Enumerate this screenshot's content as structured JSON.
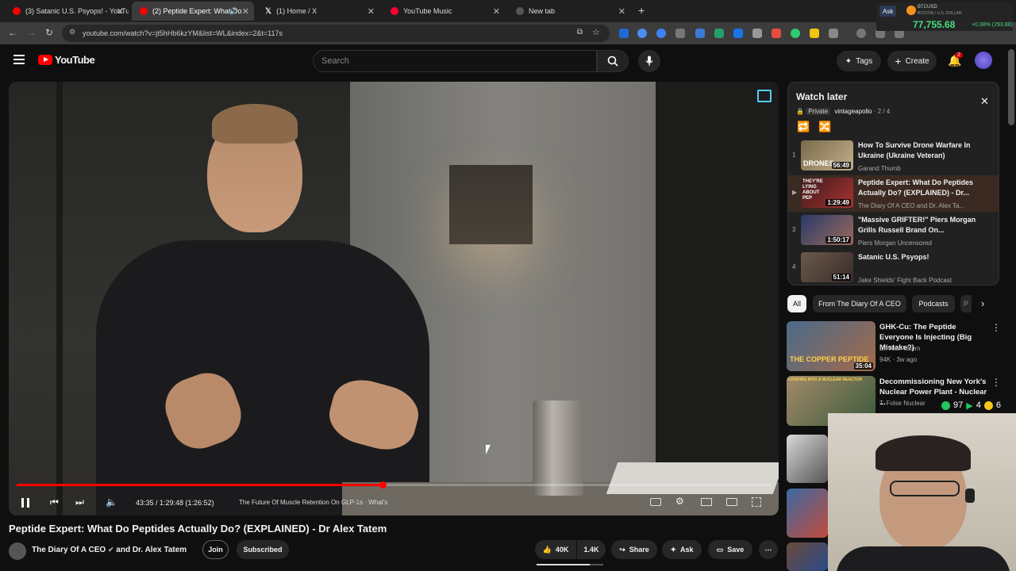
{
  "browser": {
    "tabs": [
      {
        "title": "(3) Satanic U.S. Psyops! - YouTu",
        "color": "#ff0000"
      },
      {
        "title": "(2) Peptide Expert: What Do",
        "color": "#ff0000"
      },
      {
        "title": "(1) Home / X",
        "color": "#ffffff"
      },
      {
        "title": "YouTube Music",
        "color": "#ff0033"
      },
      {
        "title": "New tab",
        "color": "#888888"
      }
    ],
    "url": "youtube.com/watch?v=jt5hHb6kzYM&list=WL&index=2&t=117s"
  },
  "ticker": {
    "ask": "Ask",
    "symbol": "BTCUSD",
    "subtitle": "BITCOIN / U.S. DOLLAR",
    "price": "77,755.68",
    "change": "+0.38% (293.88)"
  },
  "header": {
    "logo_text": "YouTube",
    "search_placeholder": "Search",
    "tags_label": "Tags",
    "create_label": "Create",
    "notif_count": "2"
  },
  "player": {
    "time": "43:35 / 1:29:48 (1:26:52)",
    "chapter": "The Future Of Muscle Retention On GLP-1s",
    "chapter_suffix": "· What's",
    "progress": 0.485
  },
  "video": {
    "title": "Peptide Expert: What Do Peptides Actually Do? (EXPLAINED) - Dr Alex Tatem",
    "channel": "The Diary Of A CEO",
    "channel_and": "and Dr. Alex Tatem",
    "join_label": "Join",
    "subscribed_label": "Subscribed",
    "likes": "40K",
    "dislikes": "1.4K",
    "share_label": "Share",
    "ask_label": "Ask",
    "save_label": "Save"
  },
  "playlist": {
    "title": "Watch later",
    "privacy": "Private",
    "owner": "vintageapollo",
    "position": "· 2 / 4",
    "items": [
      {
        "index": "1",
        "title": "How To Survive Drone Warfare In Ukraine (Ukraine Veteran)",
        "channel": "Garand Thumb",
        "duration": "56:49",
        "thumb_text": "DRONES"
      },
      {
        "index": "▶",
        "title": "Peptide Expert: What Do Peptides Actually Do? (EXPLAINED) - Dr...",
        "channel": "The Diary Of A CEO and Dr. Alex Ta...",
        "duration": "1:29:49",
        "thumb_text": "THEY'RE LYING ABOUT PEP"
      },
      {
        "index": "3",
        "title": "\"Massive GRIFTER!\" Piers Morgan Grills Russell Brand On...",
        "channel": "Piers Morgan Uncensored",
        "duration": "1:50:17",
        "thumb_text": ""
      },
      {
        "index": "4",
        "title": "Satanic U.S. Psyops!",
        "channel": "Jake Shields' Fight Back Podcast",
        "duration": "51:14",
        "thumb_text": ""
      }
    ]
  },
  "chips": [
    "All",
    "From The Diary Of A CEO",
    "Podcasts",
    "P"
  ],
  "recommendations": [
    {
      "title": "GHK-Cu: The Peptide Everyone Is Injecting (Big Mistake?)",
      "channel": "Dr. Alex Tatem",
      "meta": "94K · 3w ago",
      "duration": "35:04",
      "thumb_text": "THE COPPER PEPTIDE"
    },
    {
      "title": "Decommissioning New York's Nuclear Power Plant - Nuclear ...",
      "channel": "T. Folse Nuclear",
      "meta": "",
      "duration": "",
      "thumb_text": "LOOKING INTO A NUCLEAR REACTOR"
    }
  ],
  "overlay_counts": {
    "a": "97",
    "b": "4",
    "c": "6"
  }
}
